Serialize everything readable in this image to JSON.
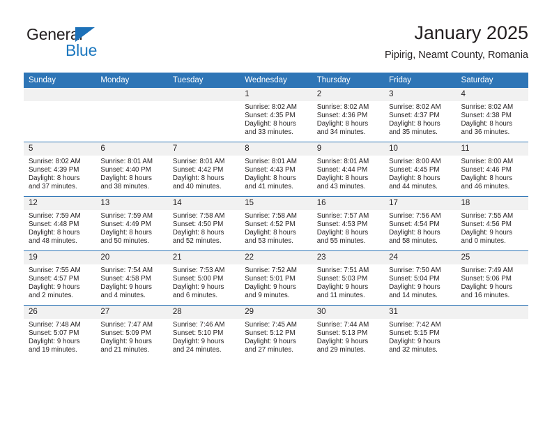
{
  "brand": {
    "name_top": "General",
    "name_bottom": "Blue",
    "accent_color": "#1d78bf",
    "triangle_color": "#1d71b8"
  },
  "header": {
    "title": "January 2025",
    "subtitle": "Pipirig, Neamt County, Romania"
  },
  "theme": {
    "header_row_bg": "#2e75b6",
    "daynum_bg": "#f1f1f1",
    "text_color": "#231f20"
  },
  "weekday_headers": [
    "Sunday",
    "Monday",
    "Tuesday",
    "Wednesday",
    "Thursday",
    "Friday",
    "Saturday"
  ],
  "weeks": [
    [
      {
        "day": "",
        "sunrise": "",
        "sunset": "",
        "daylight_line1": "",
        "daylight_line2": ""
      },
      {
        "day": "",
        "sunrise": "",
        "sunset": "",
        "daylight_line1": "",
        "daylight_line2": ""
      },
      {
        "day": "",
        "sunrise": "",
        "sunset": "",
        "daylight_line1": "",
        "daylight_line2": ""
      },
      {
        "day": "1",
        "sunrise": "Sunrise: 8:02 AM",
        "sunset": "Sunset: 4:35 PM",
        "daylight_line1": "Daylight: 8 hours",
        "daylight_line2": "and 33 minutes."
      },
      {
        "day": "2",
        "sunrise": "Sunrise: 8:02 AM",
        "sunset": "Sunset: 4:36 PM",
        "daylight_line1": "Daylight: 8 hours",
        "daylight_line2": "and 34 minutes."
      },
      {
        "day": "3",
        "sunrise": "Sunrise: 8:02 AM",
        "sunset": "Sunset: 4:37 PM",
        "daylight_line1": "Daylight: 8 hours",
        "daylight_line2": "and 35 minutes."
      },
      {
        "day": "4",
        "sunrise": "Sunrise: 8:02 AM",
        "sunset": "Sunset: 4:38 PM",
        "daylight_line1": "Daylight: 8 hours",
        "daylight_line2": "and 36 minutes."
      }
    ],
    [
      {
        "day": "5",
        "sunrise": "Sunrise: 8:02 AM",
        "sunset": "Sunset: 4:39 PM",
        "daylight_line1": "Daylight: 8 hours",
        "daylight_line2": "and 37 minutes."
      },
      {
        "day": "6",
        "sunrise": "Sunrise: 8:01 AM",
        "sunset": "Sunset: 4:40 PM",
        "daylight_line1": "Daylight: 8 hours",
        "daylight_line2": "and 38 minutes."
      },
      {
        "day": "7",
        "sunrise": "Sunrise: 8:01 AM",
        "sunset": "Sunset: 4:42 PM",
        "daylight_line1": "Daylight: 8 hours",
        "daylight_line2": "and 40 minutes."
      },
      {
        "day": "8",
        "sunrise": "Sunrise: 8:01 AM",
        "sunset": "Sunset: 4:43 PM",
        "daylight_line1": "Daylight: 8 hours",
        "daylight_line2": "and 41 minutes."
      },
      {
        "day": "9",
        "sunrise": "Sunrise: 8:01 AM",
        "sunset": "Sunset: 4:44 PM",
        "daylight_line1": "Daylight: 8 hours",
        "daylight_line2": "and 43 minutes."
      },
      {
        "day": "10",
        "sunrise": "Sunrise: 8:00 AM",
        "sunset": "Sunset: 4:45 PM",
        "daylight_line1": "Daylight: 8 hours",
        "daylight_line2": "and 44 minutes."
      },
      {
        "day": "11",
        "sunrise": "Sunrise: 8:00 AM",
        "sunset": "Sunset: 4:46 PM",
        "daylight_line1": "Daylight: 8 hours",
        "daylight_line2": "and 46 minutes."
      }
    ],
    [
      {
        "day": "12",
        "sunrise": "Sunrise: 7:59 AM",
        "sunset": "Sunset: 4:48 PM",
        "daylight_line1": "Daylight: 8 hours",
        "daylight_line2": "and 48 minutes."
      },
      {
        "day": "13",
        "sunrise": "Sunrise: 7:59 AM",
        "sunset": "Sunset: 4:49 PM",
        "daylight_line1": "Daylight: 8 hours",
        "daylight_line2": "and 50 minutes."
      },
      {
        "day": "14",
        "sunrise": "Sunrise: 7:58 AM",
        "sunset": "Sunset: 4:50 PM",
        "daylight_line1": "Daylight: 8 hours",
        "daylight_line2": "and 52 minutes."
      },
      {
        "day": "15",
        "sunrise": "Sunrise: 7:58 AM",
        "sunset": "Sunset: 4:52 PM",
        "daylight_line1": "Daylight: 8 hours",
        "daylight_line2": "and 53 minutes."
      },
      {
        "day": "16",
        "sunrise": "Sunrise: 7:57 AM",
        "sunset": "Sunset: 4:53 PM",
        "daylight_line1": "Daylight: 8 hours",
        "daylight_line2": "and 55 minutes."
      },
      {
        "day": "17",
        "sunrise": "Sunrise: 7:56 AM",
        "sunset": "Sunset: 4:54 PM",
        "daylight_line1": "Daylight: 8 hours",
        "daylight_line2": "and 58 minutes."
      },
      {
        "day": "18",
        "sunrise": "Sunrise: 7:55 AM",
        "sunset": "Sunset: 4:56 PM",
        "daylight_line1": "Daylight: 9 hours",
        "daylight_line2": "and 0 minutes."
      }
    ],
    [
      {
        "day": "19",
        "sunrise": "Sunrise: 7:55 AM",
        "sunset": "Sunset: 4:57 PM",
        "daylight_line1": "Daylight: 9 hours",
        "daylight_line2": "and 2 minutes."
      },
      {
        "day": "20",
        "sunrise": "Sunrise: 7:54 AM",
        "sunset": "Sunset: 4:58 PM",
        "daylight_line1": "Daylight: 9 hours",
        "daylight_line2": "and 4 minutes."
      },
      {
        "day": "21",
        "sunrise": "Sunrise: 7:53 AM",
        "sunset": "Sunset: 5:00 PM",
        "daylight_line1": "Daylight: 9 hours",
        "daylight_line2": "and 6 minutes."
      },
      {
        "day": "22",
        "sunrise": "Sunrise: 7:52 AM",
        "sunset": "Sunset: 5:01 PM",
        "daylight_line1": "Daylight: 9 hours",
        "daylight_line2": "and 9 minutes."
      },
      {
        "day": "23",
        "sunrise": "Sunrise: 7:51 AM",
        "sunset": "Sunset: 5:03 PM",
        "daylight_line1": "Daylight: 9 hours",
        "daylight_line2": "and 11 minutes."
      },
      {
        "day": "24",
        "sunrise": "Sunrise: 7:50 AM",
        "sunset": "Sunset: 5:04 PM",
        "daylight_line1": "Daylight: 9 hours",
        "daylight_line2": "and 14 minutes."
      },
      {
        "day": "25",
        "sunrise": "Sunrise: 7:49 AM",
        "sunset": "Sunset: 5:06 PM",
        "daylight_line1": "Daylight: 9 hours",
        "daylight_line2": "and 16 minutes."
      }
    ],
    [
      {
        "day": "26",
        "sunrise": "Sunrise: 7:48 AM",
        "sunset": "Sunset: 5:07 PM",
        "daylight_line1": "Daylight: 9 hours",
        "daylight_line2": "and 19 minutes."
      },
      {
        "day": "27",
        "sunrise": "Sunrise: 7:47 AM",
        "sunset": "Sunset: 5:09 PM",
        "daylight_line1": "Daylight: 9 hours",
        "daylight_line2": "and 21 minutes."
      },
      {
        "day": "28",
        "sunrise": "Sunrise: 7:46 AM",
        "sunset": "Sunset: 5:10 PM",
        "daylight_line1": "Daylight: 9 hours",
        "daylight_line2": "and 24 minutes."
      },
      {
        "day": "29",
        "sunrise": "Sunrise: 7:45 AM",
        "sunset": "Sunset: 5:12 PM",
        "daylight_line1": "Daylight: 9 hours",
        "daylight_line2": "and 27 minutes."
      },
      {
        "day": "30",
        "sunrise": "Sunrise: 7:44 AM",
        "sunset": "Sunset: 5:13 PM",
        "daylight_line1": "Daylight: 9 hours",
        "daylight_line2": "and 29 minutes."
      },
      {
        "day": "31",
        "sunrise": "Sunrise: 7:42 AM",
        "sunset": "Sunset: 5:15 PM",
        "daylight_line1": "Daylight: 9 hours",
        "daylight_line2": "and 32 minutes."
      },
      {
        "day": "",
        "sunrise": "",
        "sunset": "",
        "daylight_line1": "",
        "daylight_line2": ""
      }
    ]
  ]
}
